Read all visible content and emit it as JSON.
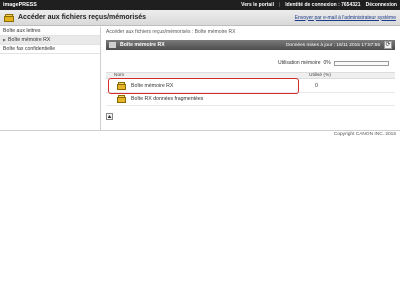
{
  "topbar": {
    "brand": "imagePRESS",
    "portal_link": "Vers le portail",
    "login_id": "Identité de connexion : 7654321",
    "logout": "Déconnexion"
  },
  "header": {
    "title": "Accéder aux fichiers reçus/mémorisés",
    "mail_link": "Envoyer par e-mail à l'administrateur système"
  },
  "sidebar": {
    "items": [
      {
        "label": "Boîte aux lettres"
      },
      {
        "label": "Boîte mémoire RX"
      },
      {
        "label": "Boîte fax confidentielle"
      }
    ]
  },
  "main": {
    "breadcrumb": "Accéder aux fichiers reçus/mémorisés : Boîte mémoire RX",
    "panel_title": "Boîte mémoire RX",
    "date": "Données mises à jour : 16/11 2015 17:57:56",
    "usage_label": "Utilisation mémoire",
    "usage_value": "0%",
    "usage_fraction": 0,
    "columns": {
      "name": "Nom",
      "used": "Utilisé (%)"
    },
    "rows": [
      {
        "name": "Boîte mémoire RX",
        "used": "0"
      },
      {
        "name": "Boîte RX données fragmentées",
        "used": ""
      }
    ]
  },
  "footer": {
    "copyright": "Copyright CANON INC. 2015"
  },
  "colors": {
    "highlight": "#d42b2b",
    "topbar": "#1f1f1f",
    "panelbar": "#5a5a5a",
    "folder": "#e6b427"
  }
}
